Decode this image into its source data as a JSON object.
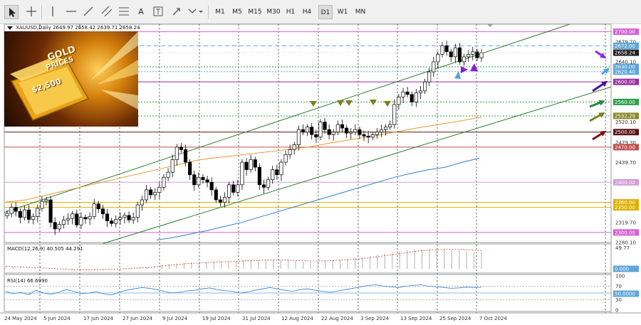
{
  "toolbar": {
    "timeframes": [
      "M1",
      "M5",
      "M15",
      "M30",
      "H1",
      "H4",
      "D1",
      "W1",
      "MN"
    ],
    "active_timeframe": "D1",
    "tools": [
      "cursor-icon",
      "crosshair-icon",
      "vertical-line-icon",
      "horizontal-line-icon",
      "trendline-icon",
      "channel-icon",
      "text-icon",
      "text-label-icon",
      "shapes-icon"
    ],
    "text_tool_label": "A"
  },
  "chart_header": {
    "symbol": "XAUUSD,Daily",
    "ohlc": "2649.97 2658.42 2639.71 2658.24"
  },
  "banner": {
    "line1": "GOLD",
    "line2": "PRICES",
    "price": "$2,500",
    "colors": {
      "bg": "#3a1a05",
      "gold": "#f0b429"
    }
  },
  "price_axis": {
    "labels": [
      "2700.00",
      "2679.70",
      "2672.00",
      "2658.24",
      "2640.10",
      "2630.00",
      "2620.40",
      "2600.00",
      "2560.00",
      "2532.29",
      "2520.10",
      "2500.00",
      "2479.30",
      "2470.00",
      "2439.70",
      "2400.00",
      "2360.00",
      "2350.00",
      "2319.70",
      "2300.00",
      "2280.10"
    ]
  },
  "badges": [
    {
      "label": "2700.00",
      "color": "#d45fd1"
    },
    {
      "label": "2672.00",
      "color": "#5fa5d9"
    },
    {
      "label": "2658.24",
      "color": "#202020"
    },
    {
      "label": "2630.00",
      "color": "#5fa5d9"
    },
    {
      "label": "2620.40",
      "color": "#5fa5d9"
    },
    {
      "label": "2600.00",
      "color": "#9b2fa3"
    },
    {
      "label": "2560.00",
      "color": "#2e9e4a"
    },
    {
      "label": "2532.29",
      "color": "#8a8a2a"
    },
    {
      "label": "2500.00",
      "color": "#5a1414"
    },
    {
      "label": "2470.00",
      "color": "#c0504d"
    },
    {
      "label": "2400.00",
      "color": "#d69ad6"
    },
    {
      "label": "2360.00",
      "color": "#e0b000"
    },
    {
      "label": "2350.00",
      "color": "#e0b000"
    },
    {
      "label": "2300.00",
      "color": "#d45fd1"
    },
    {
      "label": "0.000",
      "color": "#5fa5d9"
    },
    {
      "label": "50.0000",
      "color": "#5fa5d9"
    }
  ],
  "date_axis": {
    "labels": [
      "24 May 2024",
      "5 Jun 2024",
      "17 Jun 2024",
      "27 Jun 2024",
      "9 Jul 2024",
      "19 Jul 2024",
      "31 Jul 2024",
      "12 Aug 2024",
      "22 Aug 2024",
      "3 Sep 2024",
      "13 Sep 2024",
      "25 Sep 2024",
      "7 Oct 2024"
    ]
  },
  "macd": {
    "label": "MACD(12,26,9) 40.505 44.291",
    "axis": [
      "49.77",
      "0.000"
    ],
    "histogram": [
      4,
      5,
      4,
      3,
      2,
      1,
      0,
      -1,
      -2,
      -3,
      -3,
      -2,
      -2,
      -1,
      -1,
      0,
      1,
      2,
      3,
      5,
      7,
      9,
      11,
      13,
      14,
      15,
      15,
      16,
      17,
      18,
      18,
      19,
      20,
      21,
      21,
      22,
      22,
      21,
      20,
      19,
      18,
      18,
      19,
      20,
      21,
      22,
      24,
      26,
      28,
      31,
      34,
      37,
      40,
      43,
      45,
      47,
      48,
      49,
      49,
      48,
      46,
      44,
      42,
      41,
      40
    ],
    "signal": [
      6,
      5,
      5,
      4,
      3,
      2,
      1,
      0,
      -1,
      -2,
      -2,
      -2,
      -2,
      -2,
      -1,
      -1,
      0,
      1,
      2,
      3,
      5,
      7,
      9,
      10,
      12,
      13,
      14,
      15,
      16,
      17,
      17,
      18,
      19,
      20,
      20,
      21,
      21,
      21,
      21,
      20,
      20,
      19,
      19,
      19,
      20,
      21,
      22,
      23,
      25,
      27,
      29,
      32,
      34,
      37,
      39,
      42,
      44,
      45,
      46,
      47,
      47,
      47,
      46,
      45,
      44
    ]
  },
  "rsi": {
    "label": "RSI(14) 66.6990",
    "axis": [
      "100",
      "70",
      "50.0000",
      "30",
      "0"
    ],
    "values": [
      55,
      48,
      52,
      45,
      58,
      50,
      46,
      52,
      60,
      55,
      48,
      50,
      54,
      47,
      44,
      52,
      58,
      62,
      66,
      64,
      60,
      55,
      50,
      52,
      56,
      58,
      62,
      65,
      60,
      57,
      55,
      50,
      53,
      58,
      62,
      66,
      62,
      58,
      55,
      60,
      62,
      58,
      55,
      52,
      56,
      60,
      64,
      68,
      72,
      74,
      70,
      68,
      66,
      70,
      72,
      74,
      70,
      68,
      66,
      64,
      65,
      67,
      66,
      67
    ]
  },
  "chart_data": {
    "type": "candlestick",
    "symbol": "XAUUSD",
    "timeframe": "Daily",
    "ylim": [
      2280,
      2715
    ],
    "x_tick_labels": [
      "24 May 2024",
      "5 Jun 2024",
      "17 Jun 2024",
      "27 Jun 2024",
      "9 Jul 2024",
      "19 Jul 2024",
      "31 Jul 2024",
      "12 Aug 2024",
      "22 Aug 2024",
      "3 Sep 2024",
      "13 Sep 2024",
      "25 Sep 2024",
      "7 Oct 2024"
    ],
    "closes": [
      2338,
      2350,
      2342,
      2330,
      2345,
      2326,
      2332,
      2348,
      2362,
      2365,
      2320,
      2307,
      2316,
      2325,
      2328,
      2337,
      2315,
      2330,
      2327,
      2332,
      2357,
      2347,
      2337,
      2323,
      2318,
      2326,
      2330,
      2334,
      2325,
      2330,
      2355,
      2365,
      2385,
      2375,
      2380,
      2390,
      2410,
      2420,
      2445,
      2470,
      2465,
      2440,
      2415,
      2395,
      2410,
      2405,
      2400,
      2385,
      2365,
      2360,
      2370,
      2395,
      2380,
      2395,
      2440,
      2425,
      2445,
      2430,
      2395,
      2390,
      2405,
      2425,
      2415,
      2440,
      2455,
      2465,
      2475,
      2505,
      2500,
      2510,
      2495,
      2490,
      2520,
      2505,
      2495,
      2500,
      2515,
      2508,
      2498,
      2500,
      2505,
      2495,
      2492,
      2490,
      2495,
      2500,
      2505,
      2510,
      2515,
      2555,
      2570,
      2580,
      2575,
      2560,
      2578,
      2582,
      2600,
      2620,
      2640,
      2655,
      2672,
      2660,
      2650,
      2668,
      2640,
      2650,
      2655,
      2660,
      2648,
      2658
    ],
    "ma_fast": [
      2360,
      2365,
      2375,
      2385,
      2395,
      2405,
      2415,
      2425,
      2435,
      2445,
      2450,
      2455,
      2460,
      2465,
      2470,
      2478,
      2485,
      2492,
      2500,
      2508,
      2515,
      2522,
      2530
    ],
    "ma_slow": [
      2285,
      2290,
      2297,
      2304,
      2312,
      2320,
      2330,
      2340,
      2350,
      2360,
      2370,
      2380,
      2390,
      2400,
      2410,
      2418,
      2425,
      2430,
      2440,
      2448
    ],
    "levels": [
      2700,
      2672,
      2630,
      2620.4,
      2600,
      2560,
      2532.29,
      2500,
      2470,
      2400,
      2360,
      2350,
      2300
    ],
    "last_price": 2658.24
  }
}
